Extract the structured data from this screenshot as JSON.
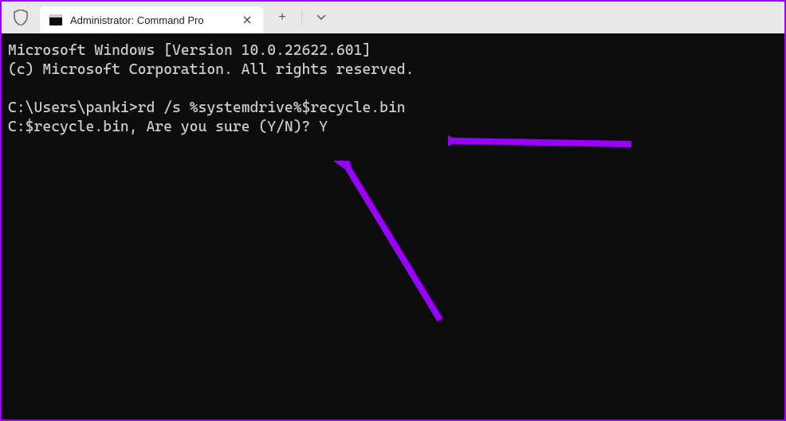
{
  "titlebar": {
    "tab_title": "Administrator: Command Pro",
    "add_tab": "+",
    "dropdown": "⌄"
  },
  "terminal": {
    "line1": "Microsoft Windows [Version 10.0.22622.601]",
    "line2": "(c) Microsoft Corporation. All rights reserved.",
    "line3": "",
    "prompt1_path": "C:\\Users\\panki>",
    "prompt1_cmd": "rd /s %systemdrive%$recycle.bin",
    "prompt2_prefix": "C:$recycle.bin, Are you sure (Y/N)? ",
    "prompt2_answer": "Y"
  },
  "colors": {
    "accent_arrow": "#9a00ff"
  }
}
